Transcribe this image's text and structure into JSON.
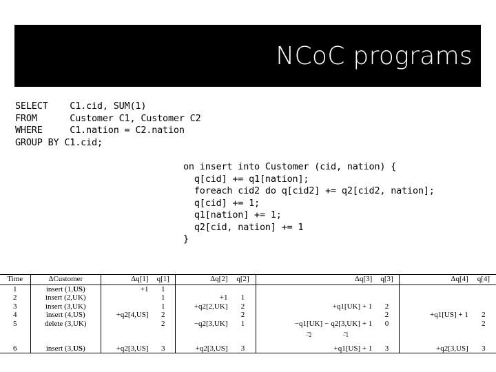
{
  "slide": {
    "title": "NCoC programs"
  },
  "sql": {
    "text": "SELECT    C1.cid, SUM(1)\nFROM      Customer C1, Customer C2\nWHERE     C1.nation = C2.nation\nGROUP BY C1.cid;"
  },
  "program": {
    "text": "on insert into Customer (cid, nation) {\n  q[cid] += q1[nation];\n  foreach cid2 do q[cid2] += q2[cid2, nation];\n  q[cid] += 1;\n  q1[nation] += 1;\n  q2[cid, nation] += 1\n}"
  },
  "trace": {
    "headers": [
      "Time",
      "ΔCustomer",
      "Δq[1]",
      "q[1]",
      "Δq[2]",
      "q[2]",
      "Δq[3]",
      "q[3]",
      "Δq[4]",
      "q[4]"
    ],
    "rows": [
      {
        "time": "1",
        "delta_customer_pre": "insert (1,",
        "delta_customer_bold": "US",
        "delta_customer_post": ")",
        "dq1": "+1",
        "q1": "1",
        "dq2": "",
        "q2": "",
        "dq3": "",
        "q3": "",
        "dq4": "",
        "q4": ""
      },
      {
        "time": "2",
        "delta_customer_pre": "insert (2,",
        "delta_customer_bold": "",
        "delta_customer_post": "UK)",
        "dq1": "",
        "q1": "1",
        "dq2": "+1",
        "q2": "1",
        "dq3": "",
        "q3": "",
        "dq4": "",
        "q4": ""
      },
      {
        "time": "3",
        "delta_customer_pre": "insert (3,",
        "delta_customer_bold": "",
        "delta_customer_post": "UK)",
        "dq1": "",
        "q1": "1",
        "dq2": "+q2[2,UK]",
        "q2": "2",
        "dq3": "+q1[UK] + 1",
        "q3": "2",
        "dq4": "",
        "q4": ""
      },
      {
        "time": "4",
        "delta_customer_pre": "insert (4,",
        "delta_customer_bold": "",
        "delta_customer_post": "US)",
        "dq1": "+q2[4,US]",
        "q1": "2",
        "dq2": "",
        "q2": "2",
        "dq3": "",
        "q3": "2",
        "dq4": "+q1[US] + 1",
        "q4": "2"
      },
      {
        "time": "5",
        "delta_customer_pre": "delete (3,",
        "delta_customer_bold": "",
        "delta_customer_post": "UK)",
        "dq1": "",
        "q1": "2",
        "dq2": "−q2[3,UK]",
        "q2": "1",
        "dq3": "",
        "q3": "0",
        "dq4": "",
        "q4": "2"
      },
      {
        "time": "6",
        "delta_customer_pre": "insert (3,",
        "delta_customer_bold": "US",
        "delta_customer_post": ")",
        "dq1": "+q2[3,US]",
        "q1": "3",
        "dq2": "+q2[3,US]",
        "q2": "3",
        "dq3": "+q1[US] + 1",
        "q3": "3",
        "dq4": "+q2[3,US]",
        "q4": "3"
      }
    ],
    "row5_dq3_annotated": {
      "term1_expr": "−q1[UK]",
      "term1_value": "−2",
      "separator": "−",
      "term2_expr": "q2[3,UK]",
      "term2_value": "−1",
      "tail": "+ 1"
    }
  }
}
